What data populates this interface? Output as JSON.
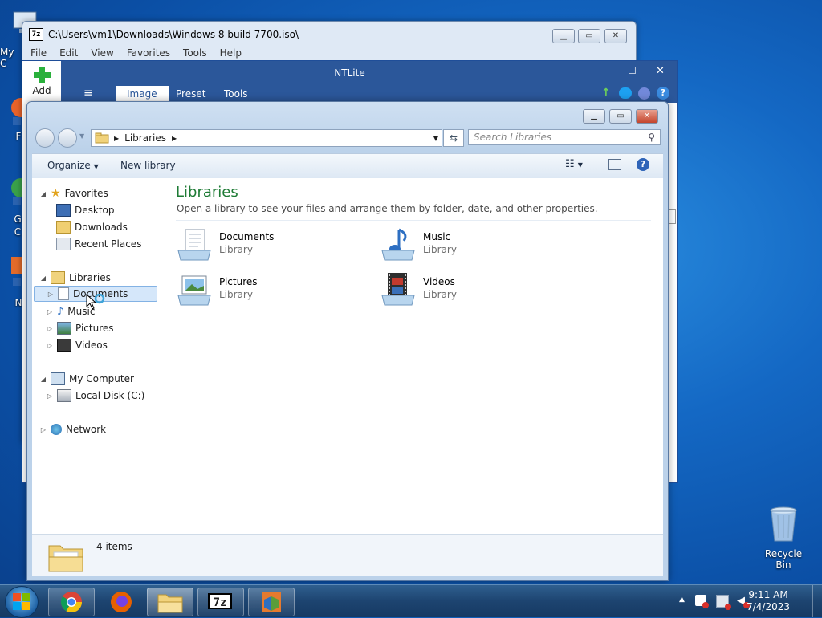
{
  "desktop": {
    "icons": [
      {
        "label": "My C"
      },
      {
        "label": "F"
      },
      {
        "label": "G"
      },
      {
        "label": "C"
      },
      {
        "label": "N"
      }
    ],
    "recycle_bin": "Recycle Bin"
  },
  "sevenzip": {
    "title": "C:\\Users\\vm1\\Downloads\\Windows 8 build 7700.iso\\",
    "badge": "7z",
    "menu": [
      "File",
      "Edit",
      "View",
      "Favorites",
      "Tools",
      "Help"
    ]
  },
  "ntlite": {
    "title": "NTLite",
    "add_label": "Add",
    "hamburger": "≡",
    "tabs": [
      "Image",
      "Preset",
      "Tools"
    ]
  },
  "explorer": {
    "breadcrumb": "Libraries",
    "search_placeholder": "Search Libraries",
    "toolbar": {
      "organize": "Organize",
      "new_library": "New library"
    },
    "nav": {
      "favorites": "Favorites",
      "desktop": "Desktop",
      "downloads": "Downloads",
      "recent": "Recent Places",
      "libraries": "Libraries",
      "documents": "Documents",
      "music": "Music",
      "pictures": "Pictures",
      "videos": "Videos",
      "computer": "My Computer",
      "local_disk": "Local Disk (C:)",
      "network": "Network"
    },
    "heading": "Libraries",
    "description": "Open a library to see your files and arrange them by folder, date, and other properties.",
    "libraries": [
      {
        "name": "Documents",
        "sub": "Library"
      },
      {
        "name": "Music",
        "sub": "Library"
      },
      {
        "name": "Pictures",
        "sub": "Library"
      },
      {
        "name": "Videos",
        "sub": "Library"
      }
    ],
    "status": "4 items"
  },
  "taskbar": {
    "time": "9:11 AM",
    "date": "7/4/2023",
    "sevenzip_badge": "7z"
  },
  "colors": {
    "accent_ntlite": "#2b579a",
    "heading_green": "#1e7b35",
    "selection": "#d5e7fa"
  }
}
